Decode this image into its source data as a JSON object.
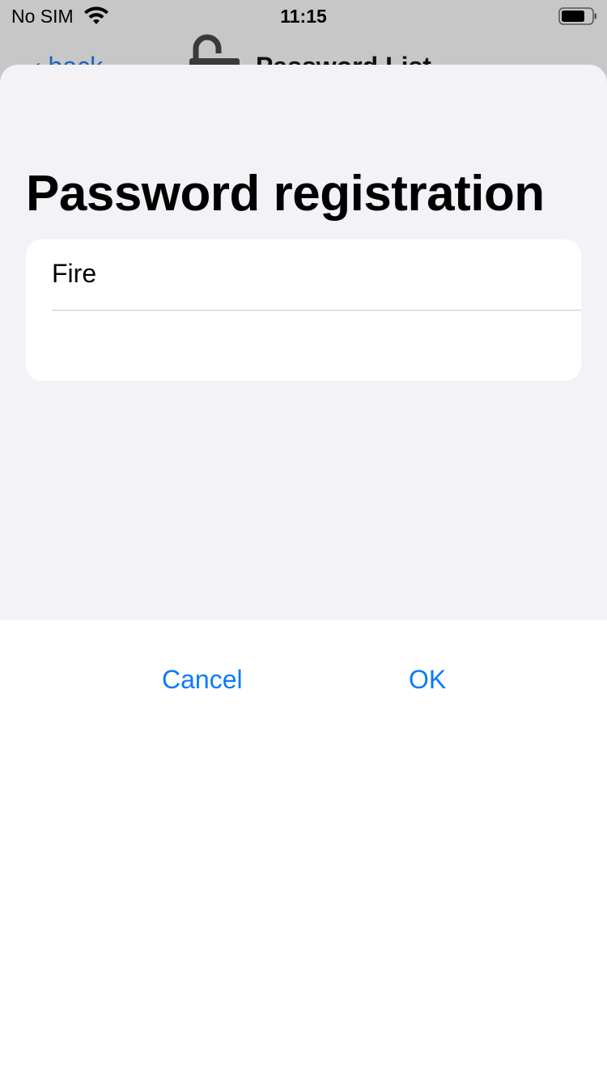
{
  "status_bar": {
    "carrier": "No SIM",
    "time": "11:15"
  },
  "background_nav": {
    "back_label": "‹ back",
    "title": "Password List"
  },
  "sheet": {
    "title": "Password registration",
    "fields": [
      {
        "value": "Fire"
      },
      {
        "value": ""
      }
    ],
    "cancel_label": "Cancel",
    "ok_label": "OK"
  },
  "colors": {
    "accent": "#0a7aff",
    "sheet_background": "#f2f2f7",
    "card_background": "#ffffff"
  }
}
